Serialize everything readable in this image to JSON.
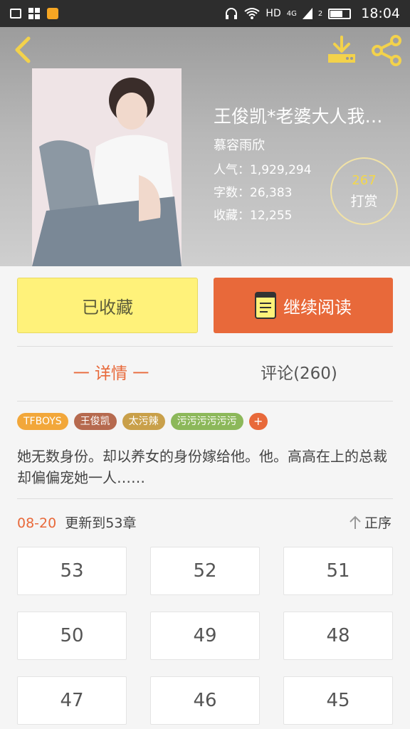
{
  "status": {
    "network": "HD",
    "signal": "4G",
    "sim": "2",
    "time": "18:04",
    "icons": [
      "image-icon",
      "grid-icon",
      "app-icon",
      "headphones-icon",
      "wifi-icon",
      "signal-icon",
      "battery-icon"
    ]
  },
  "header": {
    "back_icon": "chevron-left-icon",
    "download_icon": "download-icon",
    "share_icon": "share-icon",
    "icon_color": "#f3d24b"
  },
  "book": {
    "title": "王俊凯*老婆大人我…",
    "author": "慕容雨欣",
    "popularity": "人气：1,929,294",
    "words": "字数：26,383",
    "favorites": "收藏：12,255",
    "reward_count": "267",
    "reward_label": "打赏"
  },
  "actions": {
    "favorite_label": "已收藏",
    "read_label": "继续阅读",
    "favorite_color": "#fff27a",
    "read_color": "#e8693a"
  },
  "tabs": {
    "detail": "一 详情 一",
    "comments": "评论(260)"
  },
  "tags": [
    {
      "label": "TFBOYS",
      "color": "#f2a73a"
    },
    {
      "label": "王俊凯",
      "color": "#b66a4f"
    },
    {
      "label": "太污辣",
      "color": "#c9a04a"
    },
    {
      "label": "污污污污污污",
      "color": "#8cb85a"
    }
  ],
  "tag_add": "+",
  "description": "她无数身份。却以养女的身份嫁给他。他。高高在上的总裁却偏偏宠她一人……",
  "update": {
    "date": "08-20",
    "text": "更新到53章",
    "sort_label": "正序"
  },
  "chapters": [
    "53",
    "52",
    "51",
    "50",
    "49",
    "48",
    "47",
    "46",
    "45"
  ]
}
